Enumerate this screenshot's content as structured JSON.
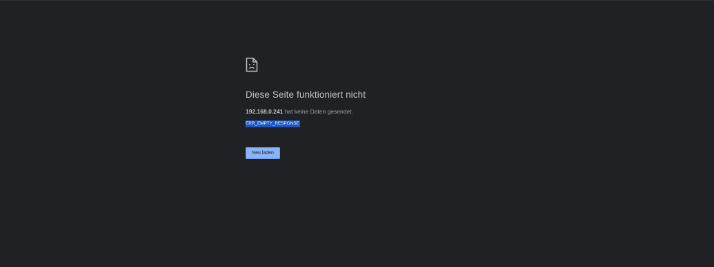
{
  "error_page": {
    "icon": "sad-document-icon",
    "headline": "Diese Seite funktioniert nicht",
    "host": "192.168.0.241",
    "summary_suffix": " hat keine Daten gesendet.",
    "error_code": "ERR_EMPTY_RESPONSE",
    "reload_label": "Neu laden"
  },
  "colors": {
    "background": "#202124",
    "headline": "#bdc1c6",
    "body_text": "#9aa0a6",
    "selection": "#1a56c4",
    "button": "#8ab4f8"
  }
}
